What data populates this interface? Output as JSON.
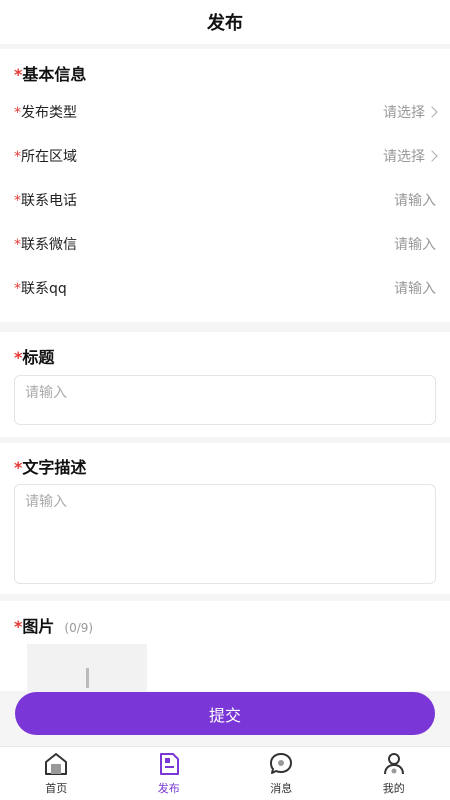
{
  "header": {
    "title": "发布"
  },
  "basic_info": {
    "title": "基本信息",
    "rows": [
      {
        "label": "发布类型",
        "value": "请选择",
        "chevron": true
      },
      {
        "label": "所在区域",
        "value": "请选择",
        "chevron": true
      },
      {
        "label": "联系电话",
        "value": "请输入",
        "chevron": false
      },
      {
        "label": "联系微信",
        "value": "请输入",
        "chevron": false
      },
      {
        "label": "联系qq",
        "value": "请输入",
        "chevron": false
      }
    ]
  },
  "title_section": {
    "title": "标题",
    "placeholder": "请输入"
  },
  "description_section": {
    "title": "文字描述",
    "placeholder": "请输入"
  },
  "image_section": {
    "title": "图片",
    "count": "(0/9)"
  },
  "submit": {
    "label": "提交"
  },
  "required_mark": "*",
  "tabbar": {
    "items": [
      {
        "label": "首页",
        "icon": "home-icon"
      },
      {
        "label": "发布",
        "icon": "publish-icon",
        "active": true
      },
      {
        "label": "消息",
        "icon": "message-icon"
      },
      {
        "label": "我的",
        "icon": "profile-icon"
      }
    ]
  },
  "colors": {
    "accent": "#7a36d6",
    "required": "#e53935",
    "placeholder": "#999999"
  }
}
